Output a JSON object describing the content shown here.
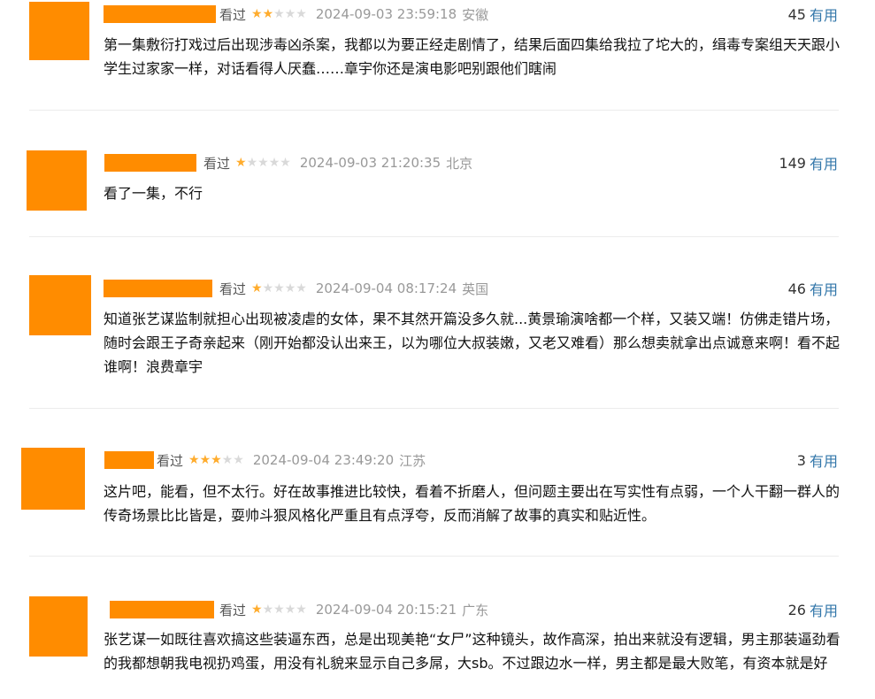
{
  "labels": {
    "watched": "看过",
    "useful": "有用"
  },
  "colors": {
    "star_on": "#ffac2d",
    "star_off": "#d9d9d9",
    "link": "#3377aa",
    "redaction": "#ff8c00"
  },
  "comments": [
    {
      "rating": 2,
      "time": "2024-09-03 23:59:18",
      "location": "安徽",
      "votes": "45",
      "content": "第一集敷衍打戏过后出现涉毒凶杀案，我都以为要正经走剧情了，结果后面四集给我拉了坨大的，缉毒专案组天天跟小学生过家家一样，对话看得人厌蠢……章宇你还是演电影吧别跟他们瞎闹"
    },
    {
      "rating": 1,
      "time": "2024-09-03 21:20:35",
      "location": "北京",
      "votes": "149",
      "content": "看了一集，不行"
    },
    {
      "rating": 1,
      "time": "2024-09-04 08:17:24",
      "location": "英国",
      "votes": "46",
      "content": "知道张艺谋监制就担心出现被凌虐的女体，果不其然开篇没多久就...黄景瑜演啥都一个样，又装又端！仿佛走错片场，随时会跟王子奇亲起来（刚开始都没认出来王，以为哪位大叔装嫩，又老又难看）那么想卖就拿出点诚意来啊！看不起谁啊！浪费章宇"
    },
    {
      "rating": 3,
      "time": "2024-09-04 23:49:20",
      "location": "江苏",
      "votes": "3",
      "content": "这片吧，能看，但不太行。好在故事推进比较快，看着不折磨人，但问题主要出在写实性有点弱，一个人干翻一群人的传奇场景比比皆是，耍帅斗狠风格化严重且有点浮夸，反而消解了故事的真实和贴近性。"
    },
    {
      "rating": 1,
      "time": "2024-09-04 20:15:21",
      "location": "广东",
      "votes": "26",
      "content": "张艺谋一如既往喜欢搞这些装逼东西，总是出现美艳“女尸”这种镜头，故作高深，拍出来就没有逻辑，男主那装逼劲看的我都想朝我电视扔鸡蛋，用没有礼貌来显示自己多屌，大sb。不过跟边水一样，男主都是最大败笔，有资本就是好"
    }
  ]
}
